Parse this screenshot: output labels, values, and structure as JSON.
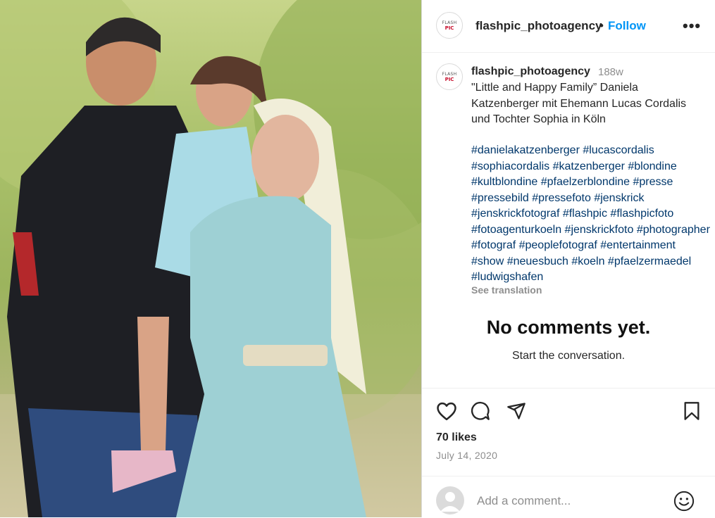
{
  "header": {
    "username": "flashpic_photoagency",
    "separator": "•",
    "follow_label": "Follow",
    "more_label": "•••",
    "avatar": {
      "line1": "FLASH",
      "line2_brand": "PIC"
    }
  },
  "caption": {
    "username": "flashpic_photoagency",
    "time_ago": "188w",
    "text": "\"Little and Happy Family” Daniela Katzenberger mit Ehemann Lucas Cordalis und Tochter Sophia in Köln",
    "hashtags": "#danielakatzenberger #lucascordalis #sophiacordalis #katzenberger #blondine #kultblondine #pfaelzerblondine #presse #pressebild #pressefoto #jenskrick #jenskrickfotograf #flashpic #flashpicfoto #fotoagenturkoeln #jenskrickfoto #photographer #fotograf #peoplefotograf #entertainment #show #neuesbuch #koeln #pfaelzermaedel #ludwigshafen",
    "see_translation": "See translation"
  },
  "comments": {
    "empty_title": "No comments yet.",
    "empty_subtitle": "Start the conversation."
  },
  "post": {
    "likes": "70 likes",
    "date": "July 14, 2020"
  },
  "comment_box": {
    "placeholder": "Add a comment..."
  },
  "icons": {
    "like": "heart-icon",
    "comment": "comment-icon",
    "share": "send-icon",
    "save": "bookmark-icon",
    "emoji": "emoji-icon",
    "more": "more-icon"
  },
  "colors": {
    "link": "#0095f6",
    "hashtag": "#00376b",
    "muted": "#8e8e8e",
    "text": "#262626"
  }
}
